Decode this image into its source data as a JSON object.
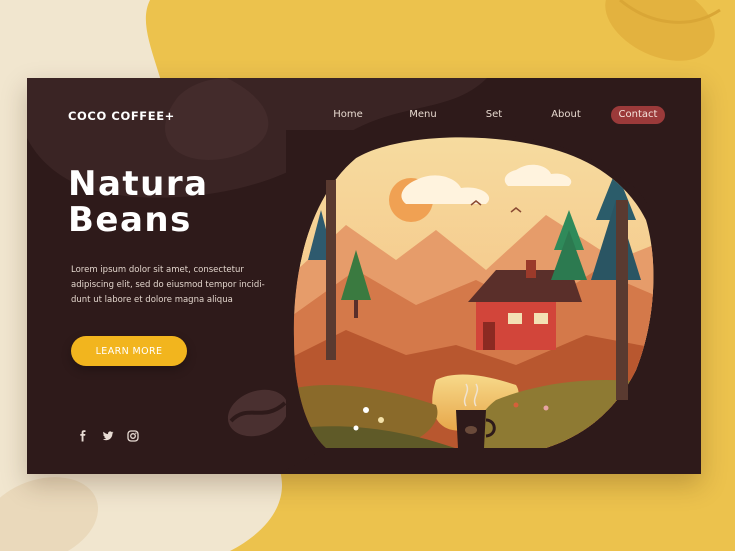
{
  "brand": {
    "logo": "COCO COFFEE+"
  },
  "nav": {
    "items": [
      {
        "label": "Home"
      },
      {
        "label": "Menu"
      },
      {
        "label": "Set"
      },
      {
        "label": "About"
      },
      {
        "label": "Contact"
      }
    ]
  },
  "hero": {
    "title_line1": "Natura",
    "title_line2": "Beans",
    "description_line1": "Lorem ipsum dolor sit amet, consectetur",
    "description_line2": "adipiscing elit, sed do eiusmod tempor incidi-",
    "description_line3": "dunt ut labore et dolore magna aliqua",
    "cta_label": "LEARN MORE"
  },
  "social": [
    "facebook-icon",
    "twitter-icon",
    "instagram-icon"
  ],
  "colors": {
    "page_background": "#f1e6cf",
    "accent_yellow": "#f2b51e",
    "card_background": "#2e1a1a",
    "contact_button": "#9b3a3a"
  }
}
